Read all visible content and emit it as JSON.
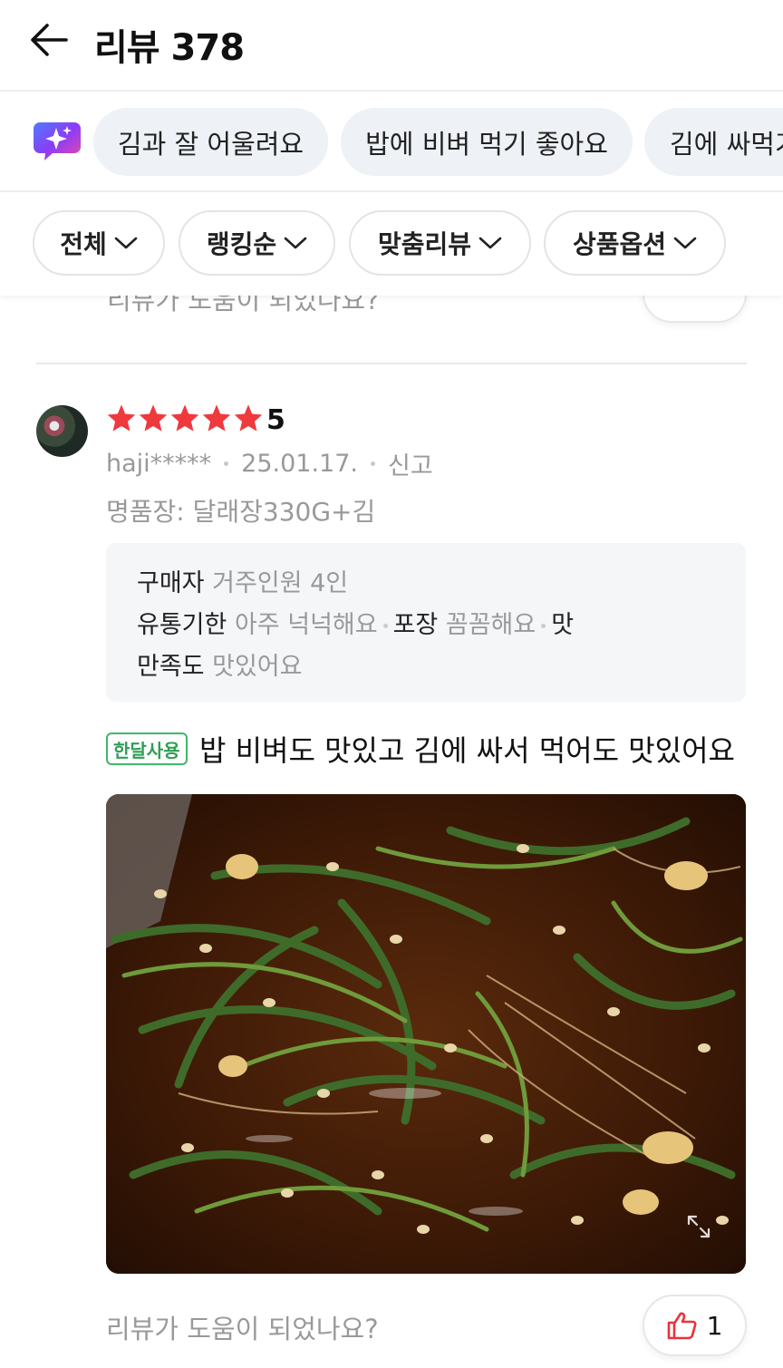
{
  "header": {
    "title": "리뷰 378"
  },
  "keywords": [
    "김과 잘 어울려요",
    "밥에 비벼 먹기 좋아요",
    "김에 싸먹기"
  ],
  "filters": [
    "전체",
    "랭킹순",
    "맞춤리뷰",
    "상품옵션"
  ],
  "prev_review": {
    "help_text": "리뷰가 도움이 되었나요?"
  },
  "review": {
    "rating": 5,
    "rating_text": "5",
    "author": "haji*****",
    "date": "25.01.17.",
    "report": "신고",
    "option": "명품장: 달래장330G+김",
    "survey": [
      {
        "key": "구매자",
        "value": "거주인원 4인"
      },
      {
        "key": "유통기한",
        "value": "아주 넉넉해요"
      },
      {
        "key": "포장",
        "value": "꼼꼼해요"
      },
      {
        "key": "맛",
        "value": ""
      },
      {
        "key": "만족도",
        "value": "맛있어요"
      }
    ],
    "badge": "한달사용",
    "text": "밥 비벼도 맛있고 김에 싸서 먹어도 맛있어요",
    "help_text": "리뷰가 도움이 되었나요?",
    "like_count": "1"
  },
  "colors": {
    "star": "#f0393d",
    "badge": "#2e9e56",
    "like_icon": "#e8333d",
    "ai_icon": "#8b3cf7"
  },
  "icons": [
    "back-arrow-icon",
    "ai-sparkle-icon",
    "chevron-down-icon",
    "star-icon",
    "thumbs-up-icon",
    "expand-icon"
  ]
}
